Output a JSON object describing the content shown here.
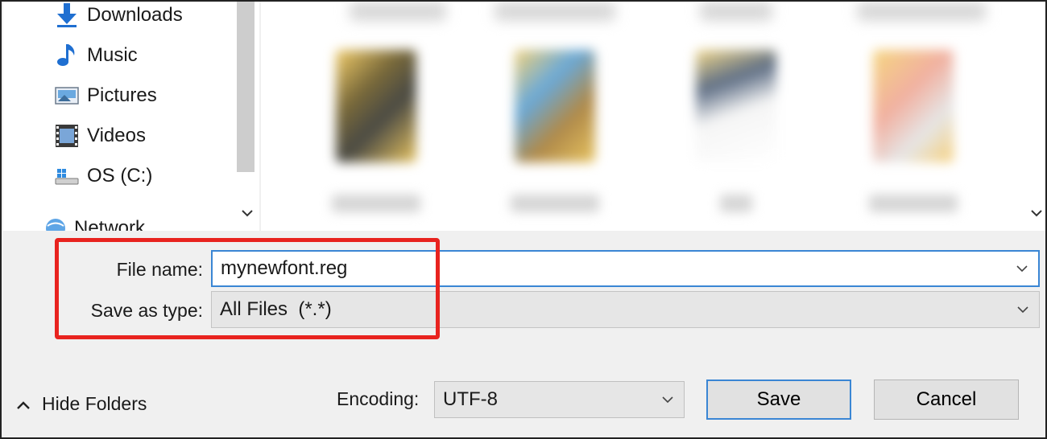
{
  "nav": {
    "items": [
      {
        "label": "Downloads",
        "icon": "download-icon"
      },
      {
        "label": "Music",
        "icon": "music-note-icon"
      },
      {
        "label": "Pictures",
        "icon": "pictures-icon"
      },
      {
        "label": "Videos",
        "icon": "videos-icon"
      },
      {
        "label": "OS (C:)",
        "icon": "drive-icon"
      },
      {
        "label": "Network",
        "icon": "network-icon"
      }
    ]
  },
  "form": {
    "filename_label": "File name:",
    "filename_value": "mynewfont.reg",
    "savetype_label": "Save as type:",
    "savetype_value": "All Files  (*.*)",
    "encoding_label": "Encoding:",
    "encoding_value": "UTF-8"
  },
  "footer": {
    "hide_folders_label": "Hide Folders",
    "save_label": "Save",
    "cancel_label": "Cancel"
  },
  "colors": {
    "highlight": "#e8231f",
    "focus_border": "#3a86d4"
  }
}
